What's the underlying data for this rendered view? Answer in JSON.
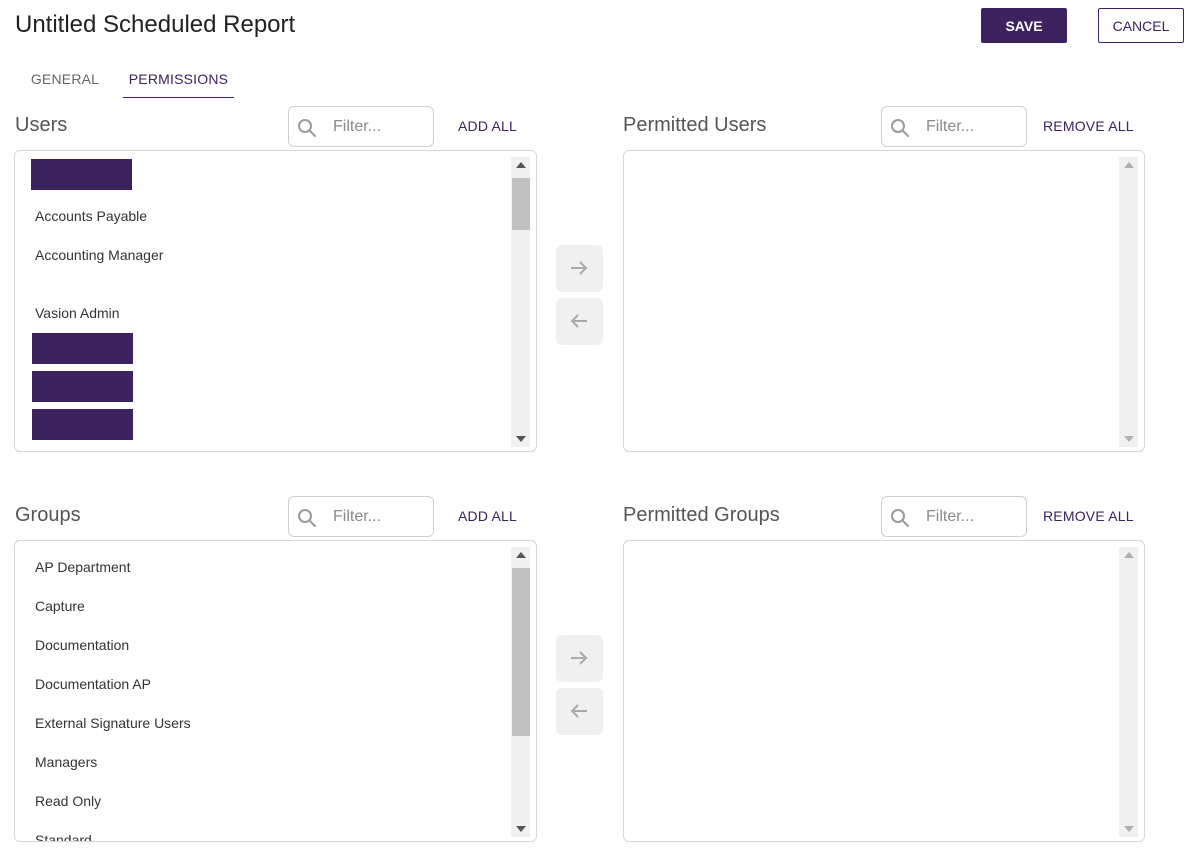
{
  "header": {
    "title": "Untitled Scheduled Report",
    "save_label": "SAVE",
    "cancel_label": "CANCEL"
  },
  "tabs": [
    {
      "label": "GENERAL",
      "active": false
    },
    {
      "label": "PERMISSIONS",
      "active": true
    }
  ],
  "users": {
    "title": "Users",
    "filter_placeholder": "Filter...",
    "add_all_label": "ADD ALL",
    "items": [
      "Accounts Payable",
      "Accounting Manager",
      "Vasion Admin"
    ]
  },
  "permitted_users": {
    "title": "Permitted Users",
    "filter_placeholder": "Filter...",
    "remove_all_label": "REMOVE ALL",
    "items": []
  },
  "groups": {
    "title": "Groups",
    "filter_placeholder": "Filter...",
    "add_all_label": "ADD ALL",
    "items": [
      "AP Department",
      "Capture",
      "Documentation",
      "Documentation AP",
      "External Signature Users",
      "Managers",
      "Read Only",
      "Standard"
    ]
  },
  "permitted_groups": {
    "title": "Permitted Groups",
    "filter_placeholder": "Filter...",
    "remove_all_label": "REMOVE ALL",
    "items": []
  },
  "icons": {
    "search": "search-icon",
    "move_right": "arrow-right-icon",
    "move_left": "arrow-left-icon"
  },
  "colors": {
    "brand": "#3d2260",
    "redaction": "#3d2260"
  }
}
